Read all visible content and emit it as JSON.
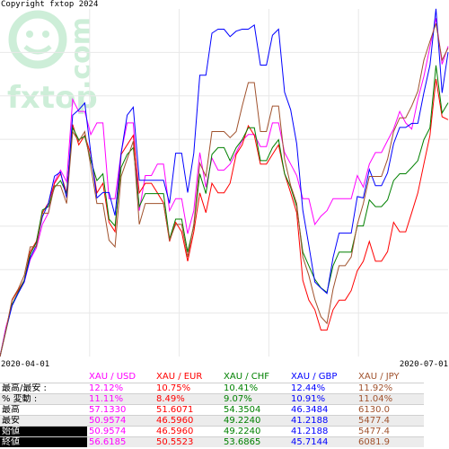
{
  "header": {
    "copyright": "Copyright fxtop 2024"
  },
  "watermark": {
    "text": "fxtop.com",
    "color": "#cdeed8"
  },
  "axis": {
    "start_date": "2020-04-01",
    "end_date": "2020-07-01"
  },
  "table": {
    "columns": [
      {
        "label": "XAU / USD",
        "color": "#ff00ff"
      },
      {
        "label": "XAU / EUR",
        "color": "#ff0000"
      },
      {
        "label": "XAU / CHF",
        "color": "#008000"
      },
      {
        "label": "XAU / GBP",
        "color": "#0000ff"
      },
      {
        "label": "XAU / JPY",
        "color": "#a0522d"
      }
    ],
    "rows": [
      {
        "label": "最高/最安 :",
        "values": [
          "12.12%",
          "10.75%",
          "10.41%",
          "12.44%",
          "11.92%"
        ],
        "colored": true
      },
      {
        "label": "% 変動 :",
        "values": [
          "11.11%",
          "8.49%",
          "9.07%",
          "10.91%",
          "11.04%"
        ],
        "colored": true
      },
      {
        "label": "最高",
        "values": [
          "57.1330",
          "51.6071",
          "54.3504",
          "46.3484",
          "6130.0"
        ],
        "colored": true
      },
      {
        "label": "最安",
        "values": [
          "50.9574",
          "46.5960",
          "49.2240",
          "41.2188",
          "5477.4"
        ],
        "colored": true
      },
      {
        "label": "始値",
        "values": [
          "50.9574",
          "46.5960",
          "49.2240",
          "41.2188",
          "5477.4"
        ],
        "colored": true
      },
      {
        "label": "終値",
        "values": [
          "56.6185",
          "50.5523",
          "53.6865",
          "45.7144",
          "6081.9"
        ],
        "colored": true
      }
    ]
  },
  "chart_data": {
    "type": "line",
    "xlabel": "",
    "ylabel": "",
    "x_range": [
      "2020-04-01",
      "2020-07-01"
    ],
    "grid": true,
    "series": [
      {
        "name": "XAU / USD",
        "color": "#ff00ff",
        "values": [
          50.96,
          51.5,
          51.91,
          52.12,
          52.32,
          52.73,
          52.94,
          53.37,
          53.58,
          54.15,
          54.36,
          54.15,
          55.65,
          55.43,
          55.43,
          55.01,
          55.22,
          55.22,
          53.84,
          53.84,
          54.68,
          55.22,
          55.22,
          53.62,
          54.26,
          54.26,
          54.47,
          54.47,
          53.62,
          53.84,
          53.84,
          53.2,
          53.62,
          54.68,
          54.05,
          54.58,
          54.36,
          54.36,
          54.47,
          54.68,
          54.9,
          55.01,
          55.01,
          54.79,
          54.79,
          55.22,
          55.22,
          54.68,
          54.47,
          54.26,
          53.84,
          53.84,
          53.37,
          53.52,
          53.62,
          53.84,
          53.84,
          53.84,
          53.84,
          54.26,
          54.05,
          54.47,
          54.68,
          54.68,
          54.9,
          55.11,
          55.43,
          55.22,
          55.11,
          55.65,
          56.07,
          56.61,
          57.13,
          56.29,
          56.62
        ]
      },
      {
        "name": "XAU / EUR",
        "color": "#ff0000",
        "values": [
          46.6,
          47.04,
          47.54,
          47.7,
          47.87,
          48.35,
          48.52,
          49.0,
          49.16,
          49.49,
          49.65,
          49.33,
          50.47,
          50.13,
          50.29,
          49.97,
          49.33,
          49.49,
          48.84,
          48.68,
          49.97,
          50.13,
          50.29,
          49.33,
          49.49,
          49.49,
          49.33,
          49.16,
          48.52,
          48.84,
          48.68,
          48.19,
          48.68,
          49.33,
          49.0,
          49.49,
          49.33,
          49.33,
          49.49,
          49.97,
          50.13,
          50.45,
          50.29,
          49.81,
          49.81,
          49.97,
          50.13,
          49.65,
          49.33,
          49.0,
          47.87,
          47.54,
          47.38,
          47.04,
          47.04,
          47.38,
          47.54,
          47.54,
          47.7,
          48.03,
          48.19,
          48.52,
          48.19,
          48.19,
          48.35,
          48.84,
          48.68,
          48.68,
          49.0,
          49.33,
          49.81,
          50.29,
          51.23,
          50.6,
          50.55
        ]
      },
      {
        "name": "XAU / CHF",
        "color": "#008000",
        "values": [
          49.22,
          49.68,
          50.14,
          50.35,
          50.56,
          51.02,
          51.23,
          51.8,
          51.86,
          52.2,
          52.32,
          52.09,
          53.25,
          53.04,
          53.1,
          52.67,
          52.32,
          52.44,
          51.64,
          51.52,
          52.55,
          52.78,
          52.9,
          51.86,
          52.09,
          52.09,
          52.09,
          52.09,
          51.29,
          51.64,
          51.64,
          51.06,
          51.52,
          52.44,
          52.09,
          52.78,
          52.9,
          52.9,
          52.67,
          52.9,
          53.04,
          53.25,
          53.25,
          52.67,
          52.67,
          52.9,
          53.04,
          52.44,
          52.2,
          51.86,
          51.06,
          50.82,
          50.58,
          50.43,
          50.35,
          50.82,
          51.06,
          51.06,
          51.06,
          51.52,
          51.52,
          51.98,
          51.86,
          51.86,
          51.98,
          52.32,
          52.44,
          52.44,
          52.55,
          52.67,
          53.04,
          53.25,
          54.35,
          53.51,
          53.69
        ]
      },
      {
        "name": "XAU / GBP",
        "color": "#0000ff",
        "values": [
          41.22,
          41.62,
          41.97,
          42.15,
          42.32,
          42.68,
          42.86,
          43.28,
          43.48,
          43.88,
          43.94,
          43.56,
          44.78,
          44.86,
          44.96,
          44.22,
          43.56,
          43.64,
          43.64,
          43.3,
          44.22,
          44.78,
          44.9,
          43.82,
          43.82,
          43.82,
          43.82,
          43.82,
          43.48,
          44.22,
          44.22,
          43.64,
          44.22,
          45.37,
          45.37,
          45.99,
          46.05,
          46.05,
          45.94,
          46.02,
          46.05,
          46.05,
          46.11,
          45.52,
          45.52,
          45.96,
          46.05,
          45.12,
          44.86,
          44.36,
          43.38,
          42.86,
          42.32,
          42.23,
          42.15,
          42.68,
          43.04,
          43.04,
          43.04,
          43.58,
          43.56,
          43.98,
          43.74,
          43.74,
          43.93,
          44.36,
          44.6,
          44.6,
          44.66,
          44.66,
          45.11,
          45.52,
          46.35,
          45.11,
          45.71
        ]
      },
      {
        "name": "XAU / JPY",
        "color": "#a0522d",
        "values": [
          5477,
          5529,
          5589,
          5609,
          5636,
          5692,
          5692,
          5758,
          5758,
          5812,
          5812,
          5777,
          5918,
          5899,
          5918,
          5850,
          5777,
          5777,
          5705,
          5692,
          5830,
          5864,
          5899,
          5736,
          5777,
          5777,
          5777,
          5777,
          5705,
          5736,
          5736,
          5672,
          5736,
          5856,
          5830,
          5918,
          5918,
          5918,
          5906,
          5918,
          5968,
          6014,
          6014,
          5918,
          5918,
          5968,
          5968,
          5864,
          5812,
          5777,
          5672,
          5636,
          5589,
          5555,
          5542,
          5609,
          5655,
          5655,
          5672,
          5736,
          5777,
          5830,
          5830,
          5830,
          5864,
          5918,
          5945,
          5945,
          5968,
          5997,
          6058,
          6095,
          6130,
          6058,
          6082
        ]
      }
    ]
  }
}
